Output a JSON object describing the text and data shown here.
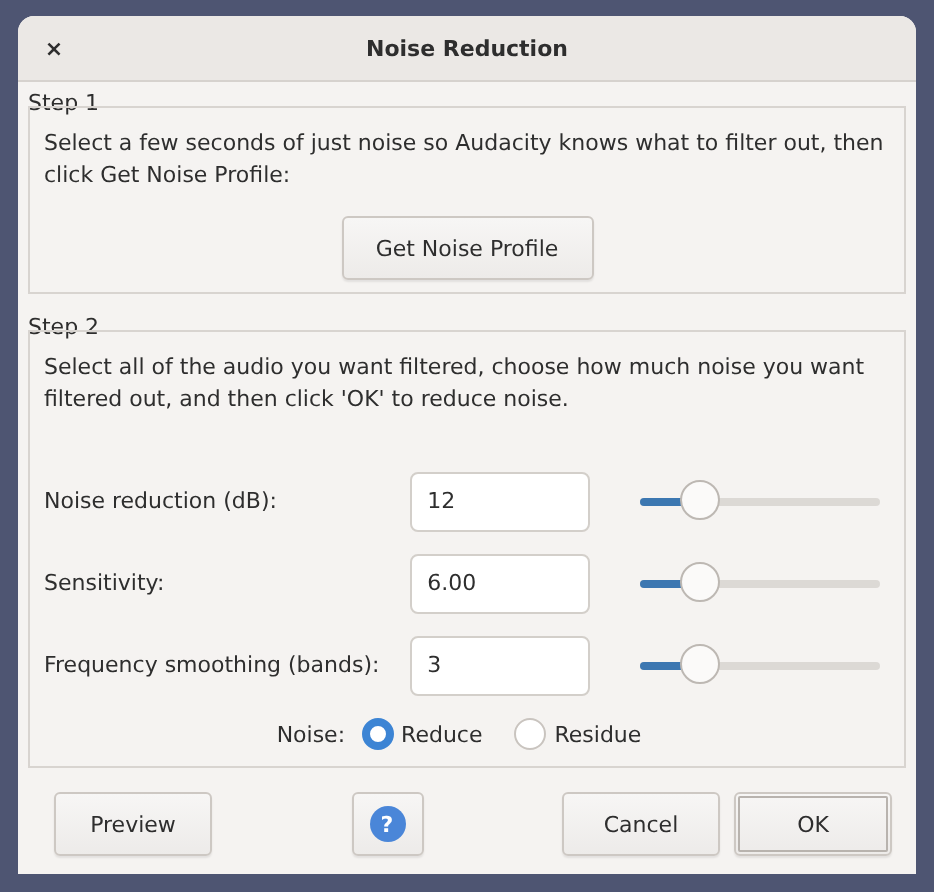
{
  "window": {
    "title": "Noise Reduction",
    "close": "×"
  },
  "step1": {
    "legend": "Step 1",
    "text": "Select a few seconds of just noise so Audacity knows what to filter out, then click Get Noise Profile:",
    "button": "Get Noise Profile"
  },
  "step2": {
    "legend": "Step 2",
    "text": "Select all of the audio you want filtered, choose how much noise you want filtered out, and then click 'OK' to reduce noise.",
    "settings": [
      {
        "label": "Noise reduction (dB):",
        "value": "12",
        "level": 0.25
      },
      {
        "label": "Sensitivity:",
        "value": "6.00",
        "level": 0.25
      },
      {
        "label": "Frequency smoothing (bands):",
        "value": "3",
        "level": 0.25
      }
    ],
    "noise": {
      "label": "Noise:",
      "options": [
        {
          "label": "Reduce",
          "selected": true
        },
        {
          "label": "Residue",
          "selected": false
        }
      ]
    }
  },
  "buttons": [
    {
      "kind": "text",
      "label": "Preview"
    },
    {
      "kind": "help",
      "label": "?"
    },
    {
      "kind": "text",
      "label": "Cancel"
    },
    {
      "kind": "text",
      "label": "OK",
      "default": true
    }
  ]
}
